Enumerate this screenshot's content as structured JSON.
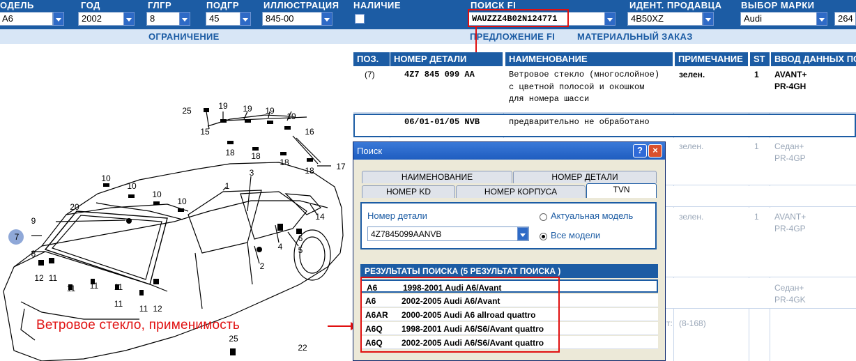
{
  "header": {
    "columns": [
      {
        "label": "ОДЕЛЬ",
        "value": "A6"
      },
      {
        "label": "ГОД",
        "value": "2002"
      },
      {
        "label": "ГЛГР",
        "value": "8"
      },
      {
        "label": "ПОДГР",
        "value": "45"
      },
      {
        "label": "ИЛЛЮСТРАЦИЯ",
        "value": "845-00"
      },
      {
        "label": "НАЛИЧИЕ",
        "value": ""
      },
      {
        "label": "ПОИСК FI",
        "value": "WAUZZZ4B02N124771"
      },
      {
        "label": "ИДЕНТ. ПРОДАВЦА",
        "value": "4B50XZ"
      },
      {
        "label": "ВЫБОР МАРКИ",
        "value": "Audi"
      }
    ],
    "extra_value": "264"
  },
  "subbar": {
    "restriction": "ОГРАНИЧЕНИЕ",
    "fi_offer": "ПРЕДЛОЖЕНИЕ FI",
    "material_order": "МАТЕРИАЛЬНЫЙ ЗАКАЗ"
  },
  "parts_table": {
    "headers": [
      "ПОЗ.",
      "НОМЕР ДЕТАЛИ",
      "НАИМЕНОВАНИЕ",
      "ПРИМЕЧАНИЕ",
      "ST",
      "ВВОД ДАННЫХ ПО"
    ],
    "row1": {
      "pos": "(7)",
      "part": "4Z7 845 099 AA",
      "name_lines": [
        "Ветровое стекло (многослойное)",
        "с цветной полосой и окошком",
        "для номера шасси"
      ],
      "note": "зелен.",
      "st": "1",
      "data_lines": [
        "AVANT+",
        "PR-4GH"
      ]
    },
    "row2": {
      "part": "06/01-01/05 NVB",
      "name": "предварительно не обработано"
    },
    "row3": {
      "note": "зелен.",
      "st": "1",
      "data_lines": [
        "Седан+",
        "PR-4GP"
      ]
    },
    "row4": {
      "note": "зелен.",
      "st": "1",
      "data_lines": [
        "AVANT+",
        "PR-4GP"
      ]
    },
    "row5": {
      "data_lines": [
        "Седан+",
        "PR-4GK"
      ]
    },
    "row6": {
      "prefix": "т:",
      "value": "(8-168)"
    }
  },
  "dialog": {
    "title": "Поиск",
    "help": "?",
    "close": "×",
    "tabs_row1": [
      "НАИМЕНОВАНИЕ",
      "НОМЕР ДЕТАЛИ"
    ],
    "tabs_row2": [
      "НОМЕР KD",
      "НОМЕР КОРПУСА",
      "TVN"
    ],
    "active_tab": "TVN",
    "part_label": "Номер детали",
    "part_value": "4Z7845099AANVB",
    "radio_current": "Актуальная модель",
    "radio_all": "Все модели",
    "radio_selected": "all",
    "results_header": "РЕЗУЛЬТАТЫ ПОИСКА  (5 РЕЗУЛЬТАТ ПОИСКА )",
    "results": [
      {
        "model": "A6",
        "desc": "1998-2001 Audi A6/Avant"
      },
      {
        "model": "A6",
        "desc": "2002-2005 Audi A6/Avant"
      },
      {
        "model": "A6AR",
        "desc": "2000-2005 Audi A6 allroad quattro"
      },
      {
        "model": "A6Q",
        "desc": "1998-2001 Audi A6/S6/Avant quattro"
      },
      {
        "model": "A6Q",
        "desc": "2002-2005 Audi A6/S6/Avant quattro"
      }
    ]
  },
  "annotation": "Ветровое стекло, применимость",
  "diagram": {
    "callouts": [
      "25",
      "19",
      "19",
      "19",
      "19",
      "15",
      "16",
      "18",
      "18",
      "18",
      "18",
      "17",
      "3",
      "10",
      "10",
      "10",
      "10",
      "1",
      "20",
      "9",
      "7",
      "8",
      "14",
      "6",
      "4",
      "5",
      "2",
      "12",
      "11",
      "11",
      "11",
      "11",
      "11",
      "11",
      "12",
      "25",
      "22"
    ]
  },
  "colors": {
    "header_bg": "#1c5ca4",
    "subbar_bg": "#d8e6f6",
    "highlight": "#e01010"
  }
}
